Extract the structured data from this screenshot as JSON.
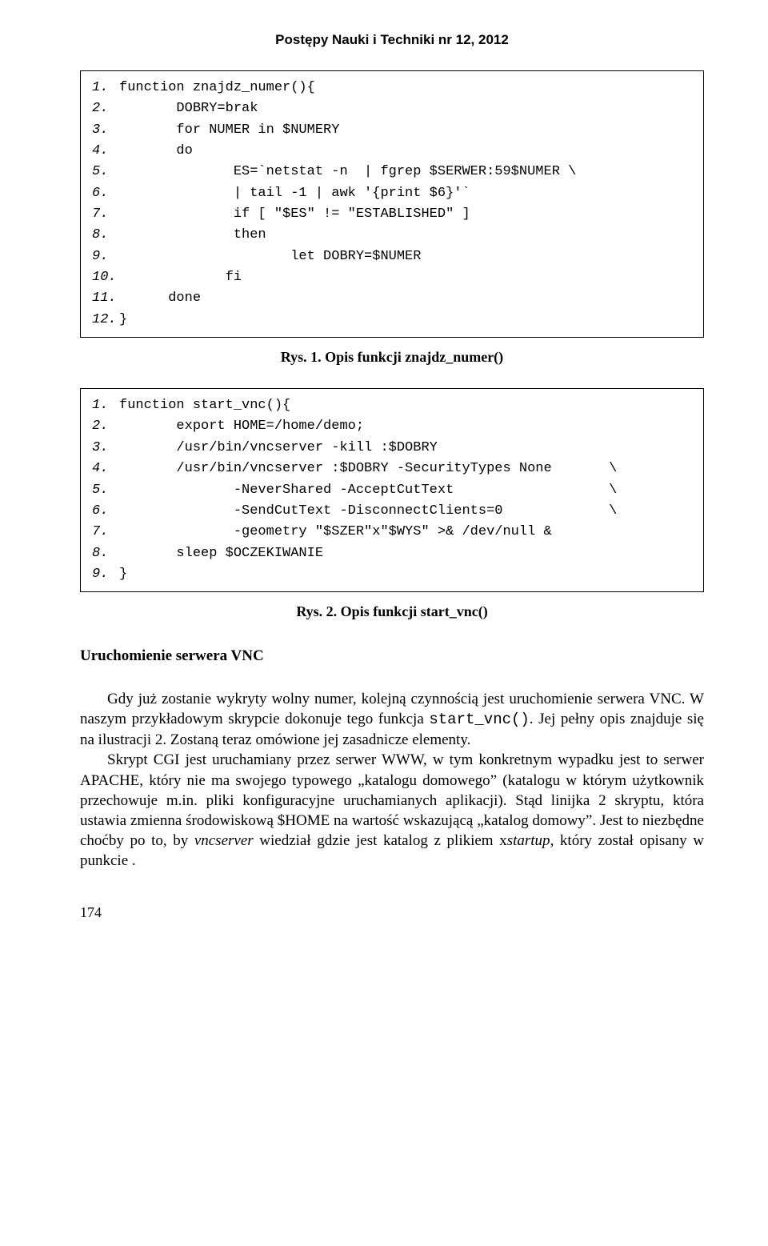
{
  "header": "Postępy Nauki i Techniki nr 12, 2012",
  "code1": {
    "lines": [
      {
        "n": "1.",
        "t": "function znajdz_numer(){"
      },
      {
        "n": "2.",
        "t": "       DOBRY=brak"
      },
      {
        "n": "3.",
        "t": "       for NUMER in $NUMERY"
      },
      {
        "n": "4.",
        "t": "       do"
      },
      {
        "n": "5.",
        "t": "              ES=`netstat -n  | fgrep $SERWER:59$NUMER \\"
      },
      {
        "n": "6.",
        "t": "              | tail -1 | awk '{print $6}'`"
      },
      {
        "n": "7.",
        "t": "              if [ \"$ES\" != \"ESTABLISHED\" ]"
      },
      {
        "n": "8.",
        "t": "              then"
      },
      {
        "n": "9.",
        "t": "                     let DOBRY=$NUMER"
      },
      {
        "n": "10.",
        "t": "             fi"
      },
      {
        "n": "11.",
        "t": "      done"
      },
      {
        "n": "12.",
        "t": "}"
      }
    ]
  },
  "caption1": "Rys. 1. Opis funkcji znajdz_numer()",
  "code2": {
    "lines": [
      {
        "n": "1.",
        "t": "function start_vnc(){"
      },
      {
        "n": "2.",
        "t": "       export HOME=/home/demo;"
      },
      {
        "n": "3.",
        "t": "       /usr/bin/vncserver -kill :$DOBRY"
      },
      {
        "n": "4.",
        "t": "       /usr/bin/vncserver :$DOBRY -SecurityTypes None       \\"
      },
      {
        "n": "5.",
        "t": "              -NeverShared -AcceptCutText                   \\"
      },
      {
        "n": "6.",
        "t": "              -SendCutText -DisconnectClients=0             \\"
      },
      {
        "n": "7.",
        "t": "              -geometry \"$SZER\"x\"$WYS\" >& /dev/null &"
      },
      {
        "n": "8.",
        "t": "       sleep $OCZEKIWANIE"
      },
      {
        "n": "9.",
        "t": "}"
      }
    ]
  },
  "caption2": "Rys. 2. Opis funkcji start_vnc()",
  "section_head": "Uruchomienie serwera VNC",
  "para1_a": "Gdy już zostanie wykryty wolny numer, kolejną czynnością jest uruchomienie serwera VNC. W naszym przykładowym skrypcie dokonuje tego funkcja ",
  "para1_mono": "start_vnc()",
  "para1_b": ". Jej pełny opis znajduje się na ilustracji 2. Zostaną teraz omówione jej zasadnicze elementy.",
  "para2_a": "Skrypt CGI jest uruchamiany przez serwer WWW, w tym konkretnym wypadku jest to serwer APACHE, który nie ma swojego typowego „katalogu domowego” (katalogu w którym użytkownik przechowuje m.in. pliki konfiguracyjne uruchamianych aplikacji). Stąd linijka 2 skryptu, która ustawia zmienna środowiskową $HOME na wartość wskazującą „katalog domowy”. Jest to niezbędne choćby po to, by ",
  "para2_em": "vncserver",
  "para2_b": " wiedział gdzie jest katalog z plikiem x",
  "para2_em2": "startup",
  "para2_c": ", który został opisany w punkcie .",
  "page_num": "174"
}
